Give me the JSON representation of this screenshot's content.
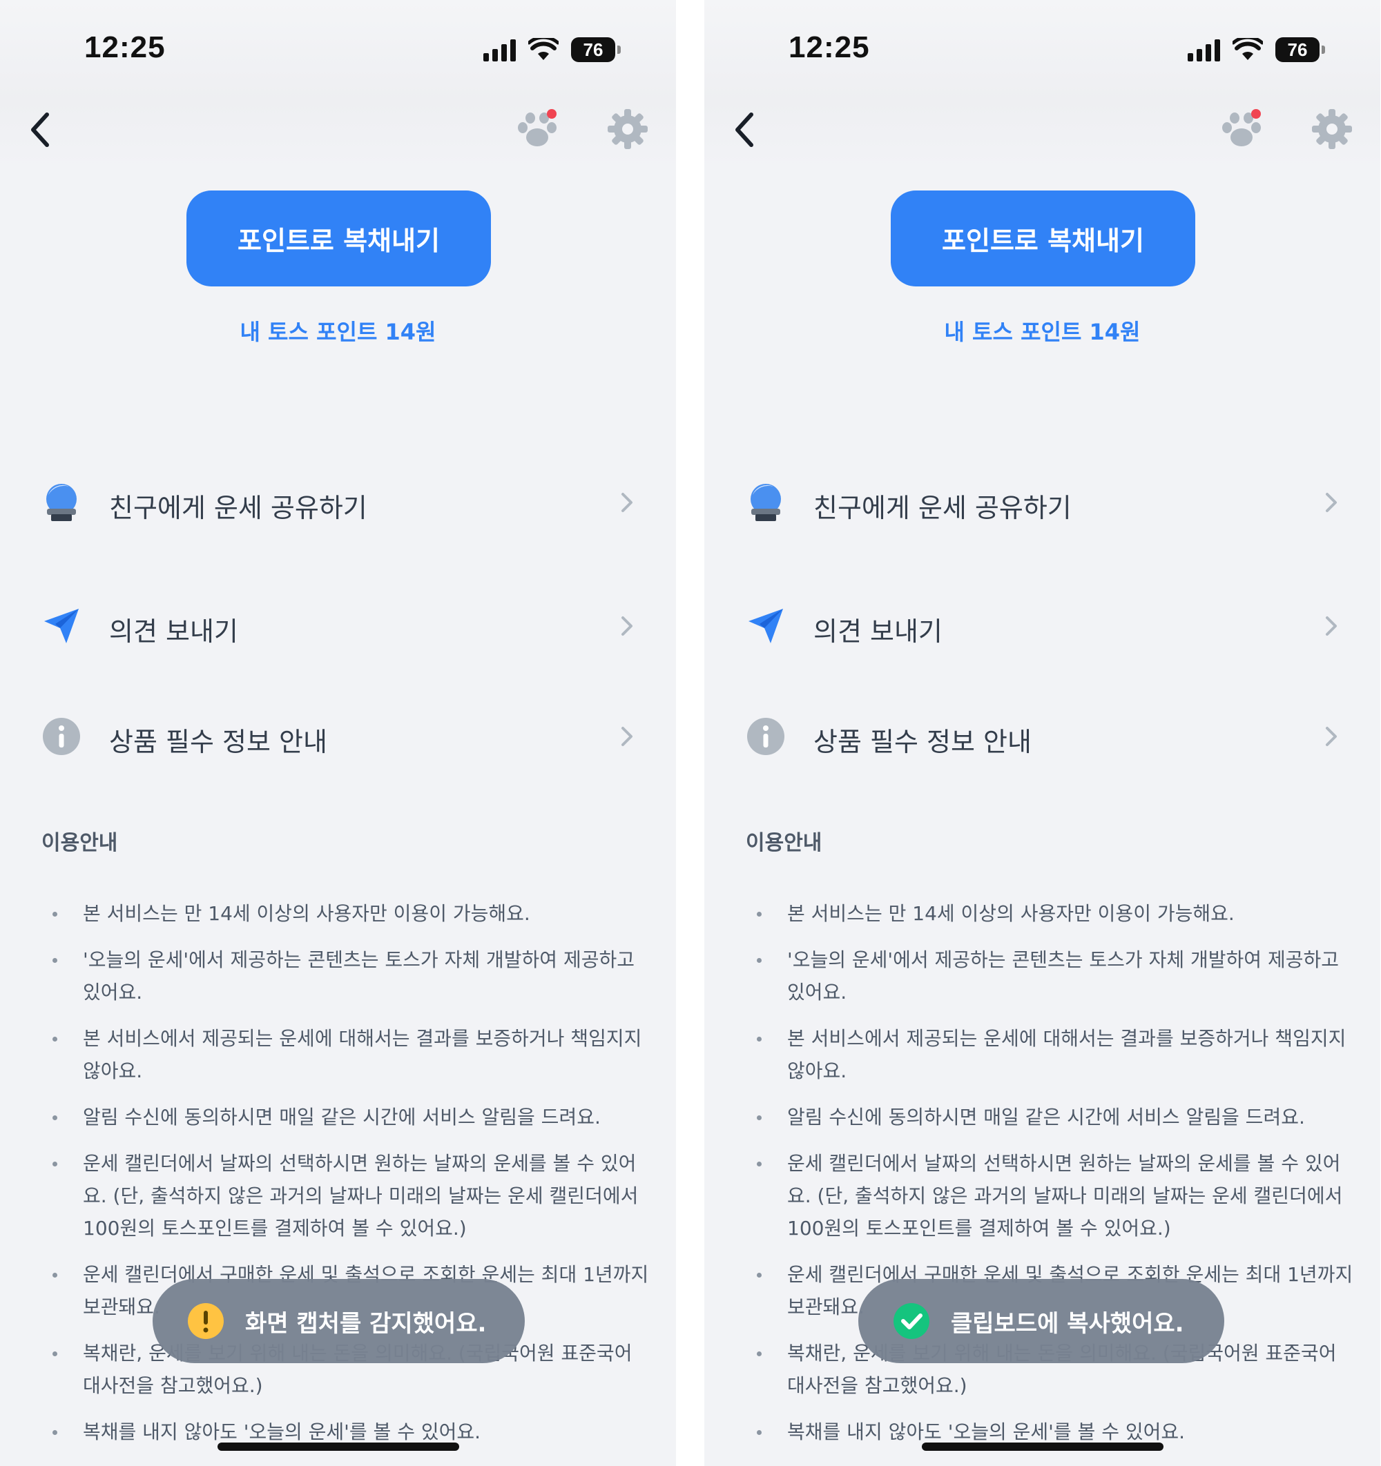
{
  "screens": [
    {
      "status": {
        "time": "12:25",
        "battery": "76"
      },
      "cta_label": "포인트로 복채내기",
      "points_label": "내 토스 포인트 14원",
      "menu": [
        {
          "label": "친구에게 운세 공유하기",
          "icon": "crystal-ball-icon"
        },
        {
          "label": "의견 보내기",
          "icon": "paper-plane-icon"
        },
        {
          "label": "상품 필수 정보 안내",
          "icon": "info-icon"
        }
      ],
      "notice_title": "이용안내",
      "notices": [
        "본 서비스는 만 14세 이상의 사용자만 이용이 가능해요.",
        "'오늘의 운세'에서 제공하는 콘텐츠는 토스가 자체 개발하여 제공하고 있어요.",
        "본 서비스에서 제공되는 운세에 대해서는 결과를 보증하거나 책임지지 않아요.",
        "알림 수신에 동의하시면 매일 같은 시간에 서비스 알림을 드려요.",
        "운세 캘린더에서 날짜의 선택하시면 원하는 날짜의 운세를 볼 수 있어요. (단, 출석하지 않은 과거의 날짜나 미래의 날짜는 운세 캘린더에서 100원의 토스포인트를 결제하여 볼 수 있어요.)",
        "운세 캘린더에서 구매한 운세 및 출석으로 조회한 운세는 최대 1년까지 보관돼요.",
        "복채란, 운세를 보기 위해 내는 돈을 의미해요. (국립국어원 표준국어 대사전을 참고했어요.)",
        "복채를 내지 않아도 '오늘의 운세'를 볼 수 있어요."
      ],
      "toast": {
        "type": "warning",
        "text": "화면 캡처를 감지했어요.",
        "icon": "exclamation-icon"
      }
    },
    {
      "status": {
        "time": "12:25",
        "battery": "76"
      },
      "cta_label": "포인트로 복채내기",
      "points_label": "내 토스 포인트 14원",
      "menu": [
        {
          "label": "친구에게 운세 공유하기",
          "icon": "crystal-ball-icon"
        },
        {
          "label": "의견 보내기",
          "icon": "paper-plane-icon"
        },
        {
          "label": "상품 필수 정보 안내",
          "icon": "info-icon"
        }
      ],
      "notice_title": "이용안내",
      "notices": [
        "본 서비스는 만 14세 이상의 사용자만 이용이 가능해요.",
        "'오늘의 운세'에서 제공하는 콘텐츠는 토스가 자체 개발하여 제공하고 있어요.",
        "본 서비스에서 제공되는 운세에 대해서는 결과를 보증하거나 책임지지 않아요.",
        "알림 수신에 동의하시면 매일 같은 시간에 서비스 알림을 드려요.",
        "운세 캘린더에서 날짜의 선택하시면 원하는 날짜의 운세를 볼 수 있어요. (단, 출석하지 않은 과거의 날짜나 미래의 날짜는 운세 캘린더에서 100원의 토스포인트를 결제하여 볼 수 있어요.)",
        "운세 캘린더에서 구매한 운세 및 출석으로 조회한 운세는 최대 1년까지 보관돼요.",
        "복채란, 운세를 보기 위해 내는 돈을 의미해요. (국립국어원 표준국어 대사전을 참고했어요.)",
        "복채를 내지 않아도 '오늘의 운세'를 볼 수 있어요."
      ],
      "toast": {
        "type": "success",
        "text": "클립보드에 복사했어요.",
        "icon": "check-circle-icon"
      }
    }
  ],
  "colors": {
    "accent": "#3182f6",
    "background": "#f2f3f6",
    "warning": "#ffc342",
    "success": "#15c47e",
    "badge": "#f04452"
  }
}
